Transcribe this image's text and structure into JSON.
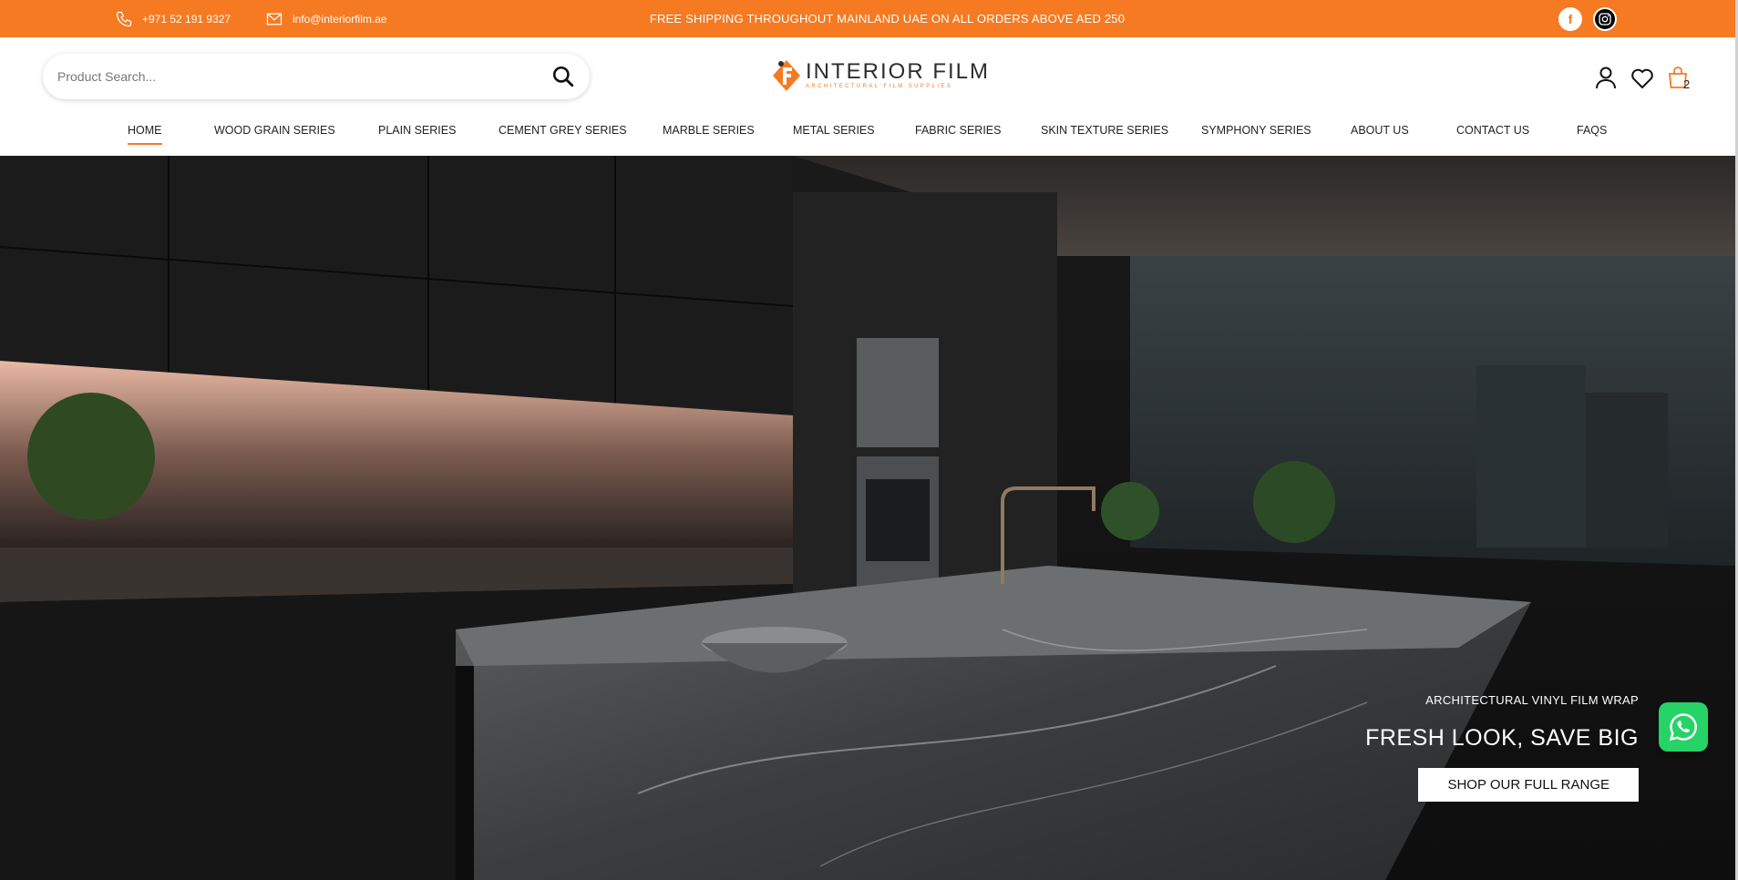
{
  "topbar": {
    "phone": "+971 52 191 9327",
    "email": "info@interiorfilm.ae",
    "shipping_notice": "FREE SHIPPING THROUGHOUT MAINLAND UAE ON ALL ORDERS ABOVE AED 250",
    "social": [
      {
        "name": "facebook-icon",
        "glyph": "f"
      },
      {
        "name": "instagram-icon",
        "glyph": "◎"
      }
    ],
    "background": "#f57a22"
  },
  "header": {
    "search_placeholder": "Product Search...",
    "logo_name": "INTERIOR FILM",
    "logo_tagline": "ARCHITECTURAL FILM SUPPLIES",
    "cart_count": "2"
  },
  "nav": {
    "items": [
      {
        "label": "HOME",
        "active": true
      },
      {
        "label": "WOOD GRAIN SERIES"
      },
      {
        "label": "PLAIN SERIES"
      },
      {
        "label": "CEMENT GREY SERIES"
      },
      {
        "label": "MARBLE SERIES"
      },
      {
        "label": "METAL SERIES"
      },
      {
        "label": "FABRIC SERIES"
      },
      {
        "label": "SKIN TEXTURE SERIES"
      },
      {
        "label": "SYMPHONY SERIES"
      },
      {
        "label": "ABOUT US"
      },
      {
        "label": "CONTACT US"
      },
      {
        "label": "FAQS"
      }
    ]
  },
  "hero": {
    "eyebrow": "ARCHITECTURAL VINYL FILM WRAP",
    "title": "FRESH LOOK, SAVE BIG",
    "cta": "SHOP OUR FULL RANGE"
  },
  "colors": {
    "accent": "#f57a22",
    "whatsapp": "#25d366"
  }
}
